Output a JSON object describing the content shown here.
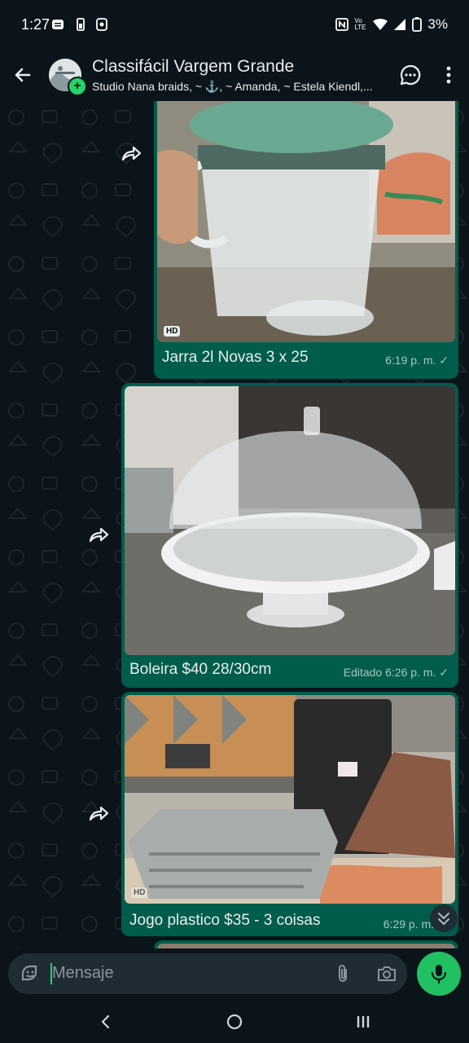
{
  "status_bar": {
    "time": "1:27",
    "battery": "3%",
    "network_label": "Vo LTE"
  },
  "header": {
    "title": "Classifácil Vargem Grande",
    "subtitle": "Studio Nana braids, ~ ⚓, ~ Amanda, ~ Estela Kiendl,..."
  },
  "messages": [
    {
      "caption": "Jarra 2l Novas 3 x 25",
      "time": "6:19 p. m.",
      "hd_badge": "HD",
      "read_mark": "✓"
    },
    {
      "caption": "Boleira $40 28/30cm",
      "time": "Editado 6:26 p. m.",
      "read_mark": "✓"
    },
    {
      "caption": "Jogo plastico $35 - 3 coisas",
      "time": "6:29 p. m.",
      "hd_badge": "HD"
    }
  ],
  "composer": {
    "placeholder": "Mensaje"
  },
  "colors": {
    "background": "#0b141a",
    "outgoing_bubble": "#005c4b",
    "accent": "#25d366",
    "composer": "#202c33"
  },
  "icons": [
    "back-arrow-icon",
    "group-avatar",
    "add-status-icon",
    "chat-call-icon",
    "more-vert-icon",
    "forward-icon",
    "chevron-down-icon",
    "sticker-icon",
    "attach-icon",
    "camera-icon",
    "mic-icon",
    "nav-back-icon",
    "nav-home-icon",
    "nav-recents-icon"
  ]
}
